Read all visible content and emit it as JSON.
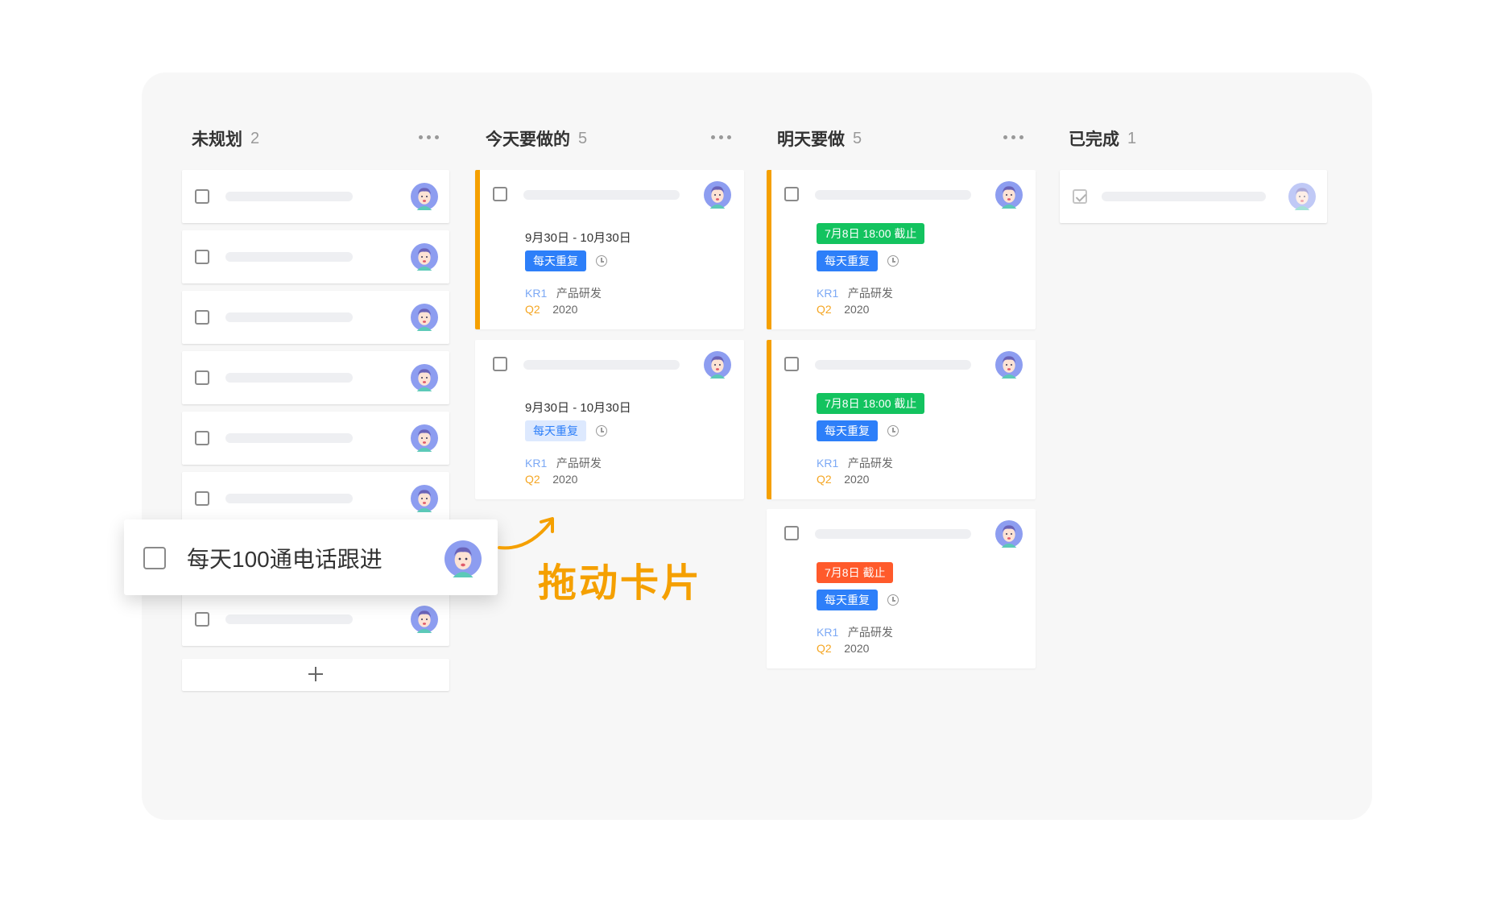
{
  "columns": [
    {
      "title": "未规划",
      "count": "2"
    },
    {
      "title": "今天要做的",
      "count": "5"
    },
    {
      "title": "明天要做",
      "count": "5"
    },
    {
      "title": "已完成",
      "count": "1"
    }
  ],
  "detail_cards": [
    {
      "date_range": "9月30日 - 10月30日",
      "repeat": "每天重复",
      "kr_label": "KR1",
      "kr_value": "产品研发",
      "q_label": "Q2",
      "q_value": "2020"
    },
    {
      "date_range": "9月30日 - 10月30日",
      "repeat": "每天重复",
      "kr_label": "KR1",
      "kr_value": "产品研发",
      "q_label": "Q2",
      "q_value": "2020"
    },
    {
      "deadline": "7月8日 18:00 截止",
      "repeat": "每天重复",
      "kr_label": "KR1",
      "kr_value": "产品研发",
      "q_label": "Q2",
      "q_value": "2020"
    },
    {
      "deadline": "7月8日 18:00 截止",
      "repeat": "每天重复",
      "kr_label": "KR1",
      "kr_value": "产品研发",
      "q_label": "Q2",
      "q_value": "2020"
    },
    {
      "deadline": "7月8日  截止",
      "repeat": "每天重复",
      "kr_label": "KR1",
      "kr_value": "产品研发",
      "q_label": "Q2",
      "q_value": "2020"
    }
  ],
  "dragging_card": {
    "title": "每天100通电话跟进"
  },
  "annotation": "拖动卡片",
  "icons": {
    "more": "more-horizontal-icon",
    "checkbox": "checkbox-icon",
    "clock": "clock-icon",
    "add": "plus-icon",
    "avatar": "avatar-icon",
    "arrow": "curved-arrow-icon"
  },
  "colors": {
    "accent": "#f5a000",
    "tag_blue": "#2d7ff9",
    "tag_green": "#13c35f",
    "tag_red": "#ff5a2b",
    "kr": "#7ba8f5",
    "q": "#f5a623"
  }
}
